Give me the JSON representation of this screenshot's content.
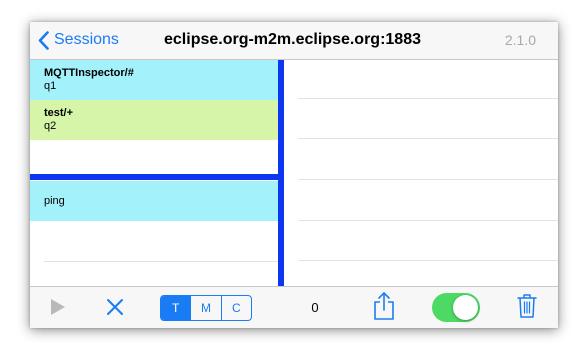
{
  "navbar": {
    "back_label": "Sessions",
    "title": "eclipse.org-m2m.eclipse.org:1883",
    "version": "2.1.0"
  },
  "subscriptions": [
    {
      "topic": "MQTTInspector/#",
      "qos": "q1",
      "color": "#a3f1fa"
    },
    {
      "topic": "test/+",
      "qos": "q2",
      "color": "#d6f5a8"
    }
  ],
  "commands": [
    {
      "label": "ping",
      "color": "#a3f1fa"
    }
  ],
  "toolbar": {
    "segments": [
      "T",
      "M",
      "C"
    ],
    "selected_segment": "T",
    "message_count": "0",
    "toggle_on": true
  },
  "colors": {
    "accent": "#1a7cf5",
    "separator": "#0d36f0",
    "toggle_on": "#4cd964"
  },
  "icons": [
    "chevron-left-icon",
    "play-icon",
    "close-icon",
    "share-icon",
    "trash-icon"
  ]
}
